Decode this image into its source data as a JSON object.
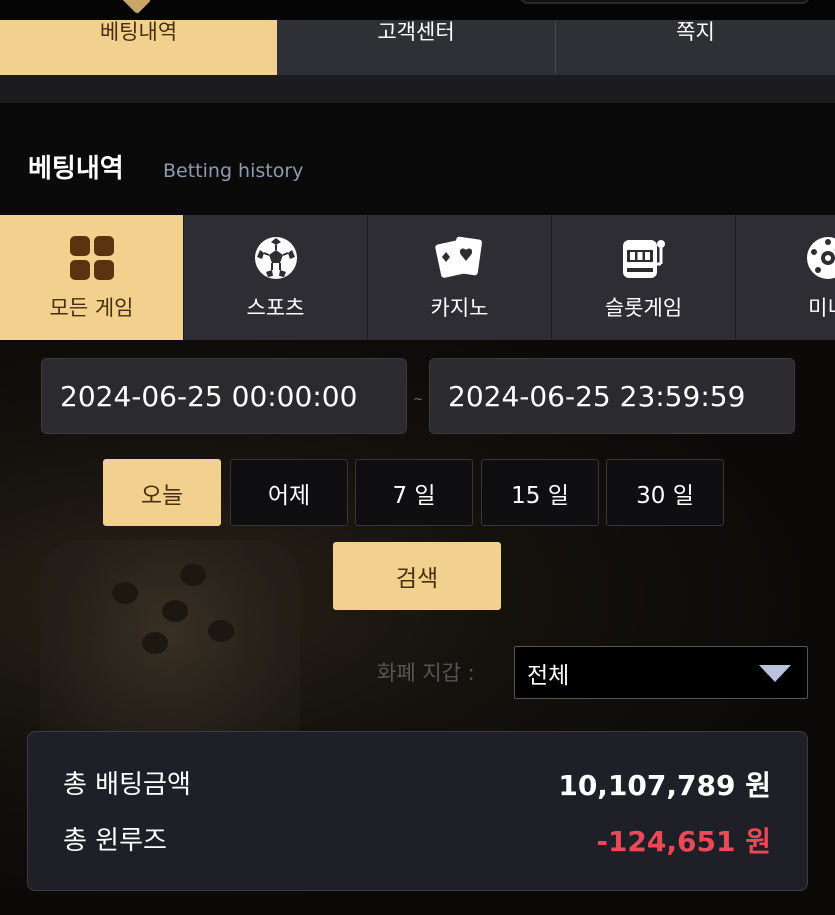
{
  "top_tabs": [
    {
      "label": "베팅내역",
      "active": true
    },
    {
      "label": "고객센터",
      "active": false
    },
    {
      "label": "쪽지",
      "active": false
    }
  ],
  "section": {
    "title": "베팅내역",
    "subtitle": "Betting history"
  },
  "game_tabs": [
    {
      "label": "모든 게임",
      "icon": "grid-icon",
      "active": true
    },
    {
      "label": "스포츠",
      "icon": "soccer-ball-icon",
      "active": false
    },
    {
      "label": "카지노",
      "icon": "playing-cards-icon",
      "active": false
    },
    {
      "label": "슬롯게임",
      "icon": "slot-machine-icon",
      "active": false
    },
    {
      "label": "미니",
      "icon": "roulette-icon",
      "active": false
    }
  ],
  "date_range": {
    "start": "2024-06-25 00:00:00",
    "separator": "~",
    "end": "2024-06-25 23:59:59"
  },
  "quick_ranges": [
    {
      "label": "오늘",
      "active": true
    },
    {
      "label": "어제",
      "active": false
    },
    {
      "label": "7 일",
      "active": false
    },
    {
      "label": "15 일",
      "active": false
    },
    {
      "label": "30 일",
      "active": false
    }
  ],
  "search_label": "검색",
  "wallet": {
    "label": "화폐 지갑 :",
    "selected": "전체"
  },
  "summary": {
    "total_bet_label": "총 배팅금액",
    "total_bet_value": "10,107,789 원",
    "win_loss_label": "총 윈루즈",
    "win_loss_value": "-124,651 원"
  },
  "colors": {
    "accent": "#f2d08d",
    "accent_text": "#4a2f0f",
    "negative": "#ea4a55"
  }
}
